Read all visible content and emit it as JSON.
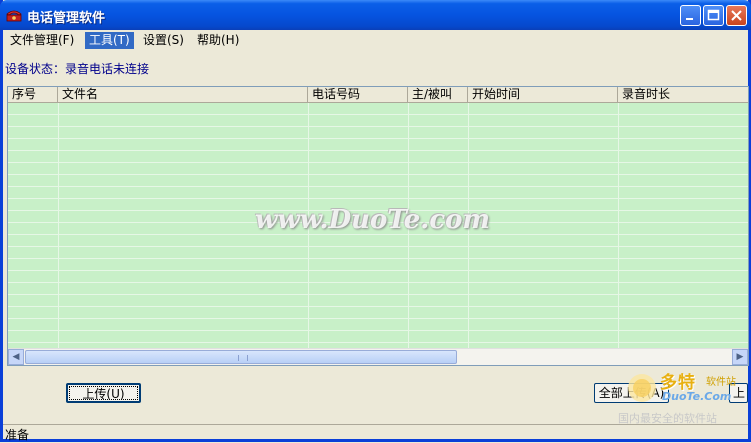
{
  "window": {
    "title": "电话管理软件",
    "buttons": [
      "minimize",
      "maximize",
      "close"
    ]
  },
  "menu": [
    {
      "label": "文件管理(F)",
      "active": false
    },
    {
      "label": "工具(T)",
      "active": true
    },
    {
      "label": "设置(S)",
      "active": false
    },
    {
      "label": "帮助(H)",
      "active": false
    }
  ],
  "device_status": "设备状态：录音电话未连接",
  "table": {
    "columns": [
      "序号",
      "文件名",
      "电话号码",
      "主/被叫",
      "开始时间",
      "录音时长"
    ],
    "rows": []
  },
  "buttons": {
    "upload": "上传(U)",
    "upload_all": "全部上传(A)",
    "partial_right": "上传"
  },
  "statusbar": {
    "text": "准备"
  },
  "watermark": {
    "text": "www.DuoTe.com",
    "logo_cn": "多特",
    "logo_sub": "软件站",
    "logo_en": "DuoTe.Com",
    "logo_tag": "国内最安全的软件站"
  },
  "colors": {
    "title_bar": "#0654e0",
    "grid_bg": "#c8f0c8",
    "menu_active": "#316ac5",
    "status_text": "#00008b"
  }
}
